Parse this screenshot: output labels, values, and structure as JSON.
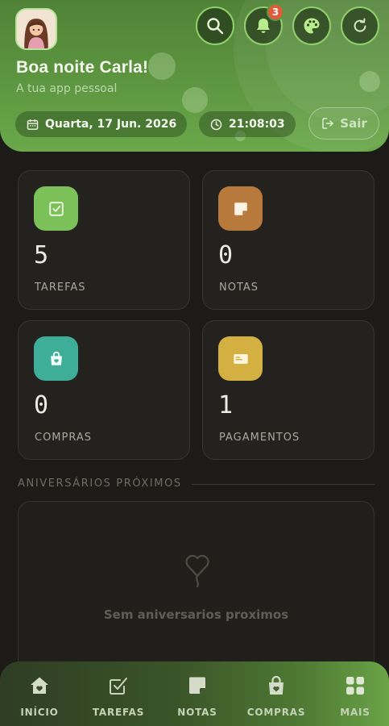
{
  "header": {
    "greeting": "Boa noite Carla!",
    "subtitle": "A tua app pessoal",
    "date": "Quarta, 17 Jun. 2026",
    "time": "21:08:03",
    "logout_label": "Sair",
    "notification_count": "3",
    "actions": [
      "search-icon",
      "bell-icon",
      "palette-icon",
      "refresh-icon"
    ]
  },
  "cards": [
    {
      "value": "5",
      "label": "TAREFAS",
      "icon": "check-icon",
      "color": "#7cc05a"
    },
    {
      "value": "0",
      "label": "NOTAS",
      "icon": "note-icon",
      "color": "#b87a3c"
    },
    {
      "value": "0",
      "label": "COMPRAS",
      "icon": "shopping-bag-icon",
      "color": "#3fae98"
    },
    {
      "value": "1",
      "label": "PAGAMENTOS",
      "icon": "card-icon",
      "color": "#d4b042"
    }
  ],
  "birthdays": {
    "title": "ANIVERSÁRIOS PRÓXIMOS",
    "empty_text": "Sem aniversarios proximos"
  },
  "nav": [
    {
      "label": "INÍCIO",
      "icon": "home-icon"
    },
    {
      "label": "TAREFAS",
      "icon": "check-icon"
    },
    {
      "label": "NOTAS",
      "icon": "note-icon"
    },
    {
      "label": "COMPRAS",
      "icon": "shopping-bag-icon"
    },
    {
      "label": "MAIS",
      "icon": "grid-icon"
    }
  ]
}
